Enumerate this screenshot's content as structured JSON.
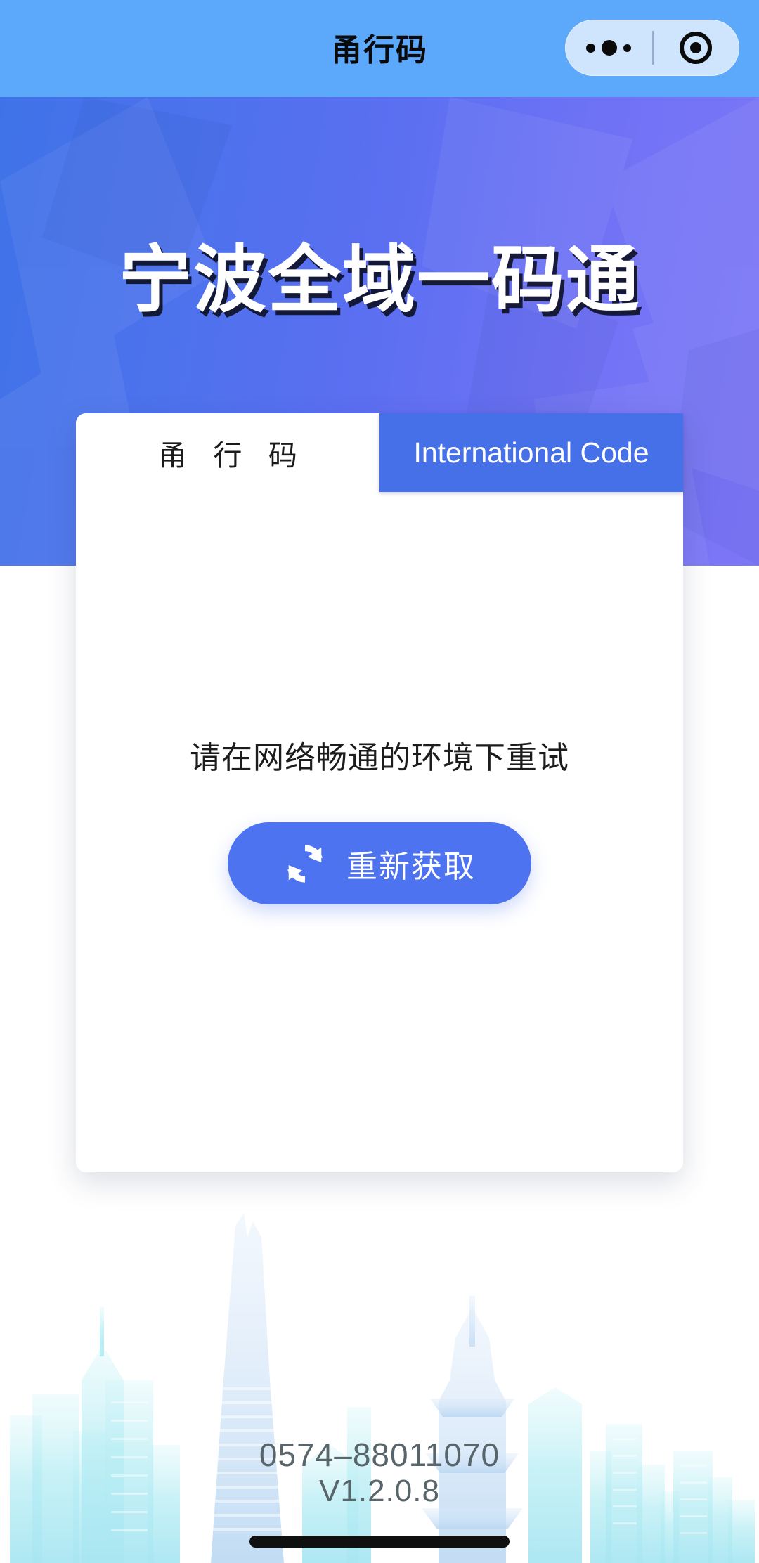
{
  "navbar": {
    "title": "甬行码",
    "capsule": {
      "menu_icon": "more-dots-icon",
      "close_icon": "target-circle-icon"
    }
  },
  "hero": {
    "title": "宁波全域一码通",
    "gradient_from": "#3F72E8",
    "gradient_to": "#7E77F7"
  },
  "card": {
    "tabs": [
      {
        "label": "甬 行 码",
        "active": false,
        "name": "tab-yongxingma"
      },
      {
        "label": "International Code",
        "active": true,
        "name": "tab-international-code"
      }
    ],
    "active_tab_color": "#4670E8",
    "error_message": "请在网络畅通的环境下重试",
    "retry_button": {
      "label": "重新获取",
      "icon": "sync-refresh-icon",
      "color": "#4D73F0"
    }
  },
  "footer": {
    "phone": "0574–88011070",
    "version": "V1.2.0.8",
    "text_color": "#58656B"
  },
  "background": {
    "skyline_icon": "ningbo-city-skyline",
    "skyline_color": "#BFF0F5"
  }
}
